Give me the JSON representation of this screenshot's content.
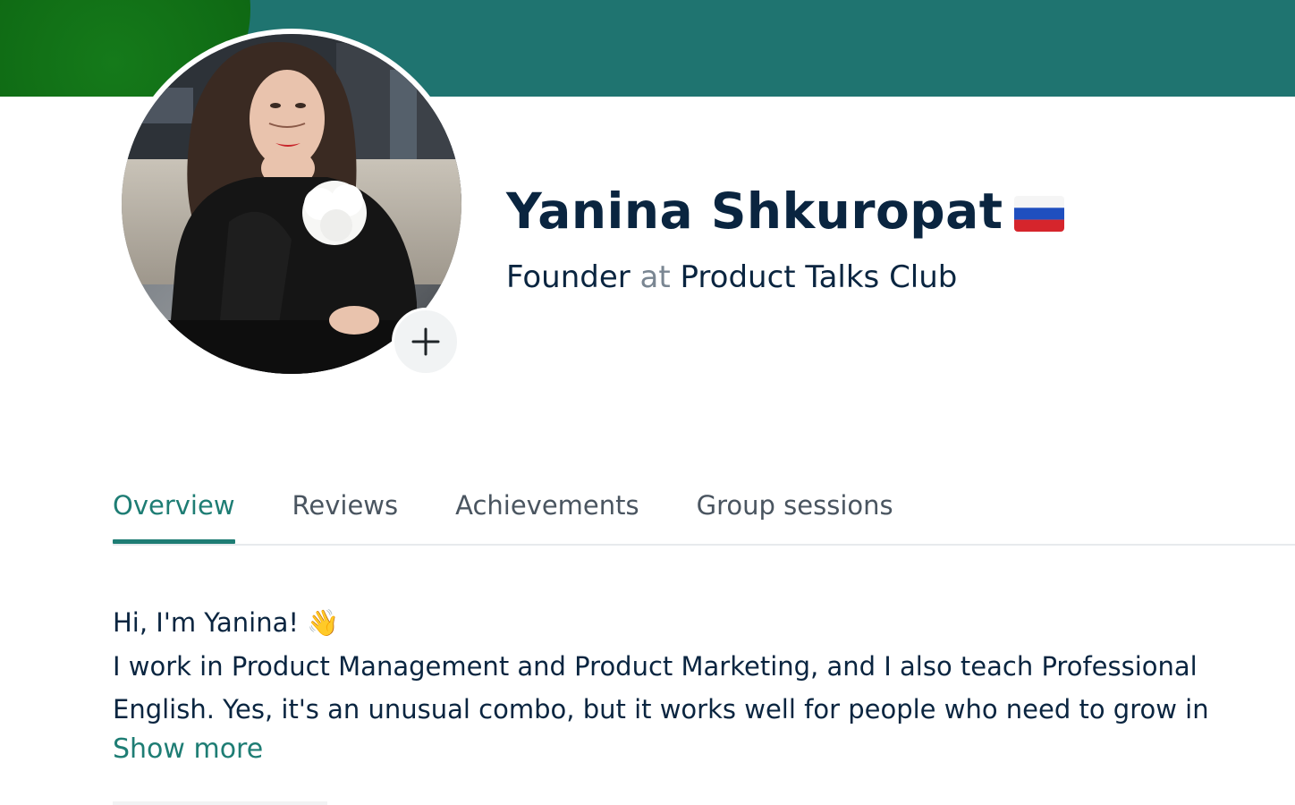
{
  "profile": {
    "name": "Yanina Shkuropat",
    "flag": "🇷🇺",
    "flag_icon": "russia-flag-icon",
    "role": "Founder",
    "at": "at",
    "company": "Product Talks Club",
    "add_photo_icon": "plus-icon"
  },
  "tabs": [
    {
      "label": "Overview",
      "active": true
    },
    {
      "label": "Reviews",
      "active": false
    },
    {
      "label": "Achievements",
      "active": false
    },
    {
      "label": "Group sessions",
      "active": false
    }
  ],
  "about": {
    "greeting": "Hi, I'm Yanina! 👋",
    "text": "I work in Product Management and Product Marketing, and I also teach Professional English. Yes, it's an unusual combo, but it works well for people who need to grow in",
    "show_more": "Show more"
  },
  "colors": {
    "banner": "#1f7470",
    "accent": "#1e7d74",
    "text": "#0a2540",
    "muted": "#7a8692"
  }
}
